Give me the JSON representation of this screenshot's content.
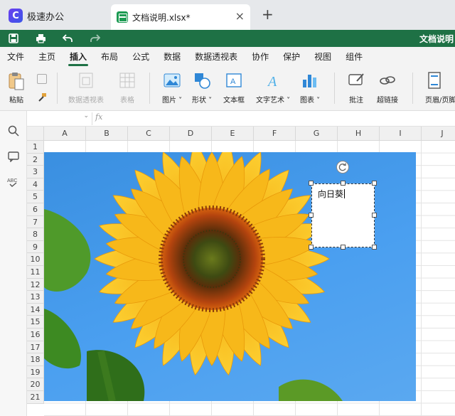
{
  "app": {
    "name": "极速办公",
    "logo_letter": "C"
  },
  "tabs": [
    {
      "label": "文档说明.xlsx*",
      "close": "×"
    }
  ],
  "new_tab": "+",
  "quickbar": {
    "title": "文档说明"
  },
  "menu": [
    "文件",
    "主页",
    "插入",
    "布局",
    "公式",
    "数据",
    "数据透视表",
    "协作",
    "保护",
    "视图",
    "组件"
  ],
  "active_menu": "插入",
  "ribbon": {
    "paste": "粘贴",
    "pivot": "数据透视表",
    "table": "表格",
    "picture": "图片",
    "shape": "形状",
    "textbox": "文本框",
    "wordart": "文字艺术",
    "chart": "图表",
    "comment": "批注",
    "hyperlink": "超链接",
    "header_footer": "页眉/页脚"
  },
  "formula_bar": {
    "fx": "fx"
  },
  "columns": [
    "A",
    "B",
    "C",
    "D",
    "E",
    "F",
    "G",
    "H",
    "I",
    "J"
  ],
  "rows": [
    "1",
    "2",
    "3",
    "4",
    "5",
    "6",
    "7",
    "8",
    "9",
    "10",
    "11",
    "12",
    "13",
    "14",
    "15",
    "16",
    "17",
    "18",
    "19",
    "20",
    "21"
  ],
  "textbox_text": "向日葵"
}
